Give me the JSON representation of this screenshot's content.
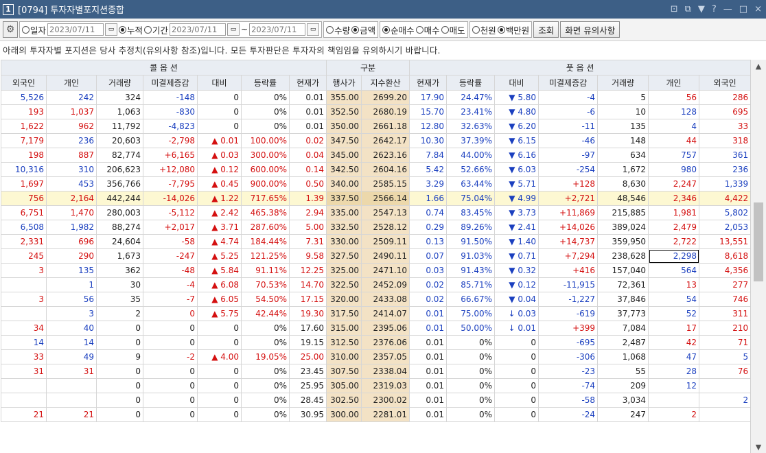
{
  "window": {
    "number": "1",
    "title": "[0794] 투자자별포지션종합",
    "controls": [
      "⊡",
      "⧉",
      "▼",
      "?",
      "—",
      "□",
      "×"
    ]
  },
  "toolbar": {
    "radio_ilja": "일자",
    "date_single": "2023/07/11",
    "radio_nujeok": "누적",
    "radio_gigan": "기간",
    "date_from": "2023/07/11",
    "date_sep": "~",
    "date_to": "2023/07/11",
    "radio_suryang": "수량",
    "radio_geumaek": "금액",
    "radio_sunmaesu": "순매수",
    "radio_maesu": "매수",
    "radio_maedo": "매도",
    "radio_cheonwon": "천원",
    "radio_baekmanwon": "백만원",
    "btn_query": "조회",
    "btn_notice": "화면 유의사항"
  },
  "notice_text": "아래의 투자자별 포지션은 당사 추정치(유의사항 참조)입니다. 모든 투자판단은 투자자의 책임임을 유의하시기 바랍니다.",
  "table": {
    "group_headers": {
      "call": "콜 옵 션",
      "mid": "구분",
      "put": "풋 옵 션"
    },
    "columns": [
      "외국인",
      "개인",
      "거래량",
      "미결제증감",
      "대비",
      "등락률",
      "현재가",
      "행사가",
      "지수환산",
      "현재가",
      "등락률",
      "대비",
      "미결제증감",
      "거래량",
      "개인",
      "외국인"
    ],
    "rows": [
      [
        "5,526",
        "242",
        "324",
        "-148",
        "0",
        "0%",
        "0.01",
        "355.00",
        "2699.20",
        "17.90",
        "24.47%",
        "▼ 5.80",
        "-4",
        "5",
        "56",
        "286"
      ],
      [
        "193",
        "1,037",
        "1,063",
        "-830",
        "0",
        "0%",
        "0.01",
        "352.50",
        "2680.19",
        "15.70",
        "23.41%",
        "▼ 4.80",
        "-6",
        "10",
        "128",
        "695"
      ],
      [
        "1,622",
        "962",
        "11,792",
        "-4,823",
        "0",
        "0%",
        "0.01",
        "350.00",
        "2661.18",
        "12.80",
        "32.63%",
        "▼ 6.20",
        "-11",
        "135",
        "4",
        "33"
      ],
      [
        "7,179",
        "236",
        "20,603",
        "-2,798",
        "▲ 0.01",
        "100.00%",
        "0.02",
        "347.50",
        "2642.17",
        "10.30",
        "37.39%",
        "▼ 6.15",
        "-46",
        "148",
        "44",
        "318"
      ],
      [
        "198",
        "887",
        "82,774",
        "+6,165",
        "▲ 0.03",
        "300.00%",
        "0.04",
        "345.00",
        "2623.16",
        "7.84",
        "44.00%",
        "▼ 6.16",
        "-97",
        "634",
        "757",
        "361"
      ],
      [
        "10,316",
        "310",
        "206,623",
        "+12,080",
        "▲ 0.12",
        "600.00%",
        "0.14",
        "342.50",
        "2604.16",
        "5.42",
        "52.66%",
        "▼ 6.03",
        "-254",
        "1,672",
        "980",
        "236"
      ],
      [
        "1,697",
        "453",
        "356,766",
        "-7,795",
        "▲ 0.45",
        "900.00%",
        "0.50",
        "340.00",
        "2585.15",
        "3.29",
        "63.44%",
        "▼ 5.71",
        "+128",
        "8,630",
        "2,247",
        "1,339"
      ],
      [
        "756",
        "2,164",
        "442,244",
        "-14,026",
        "▲ 1.22",
        "717.65%",
        "1.39",
        "337.50",
        "2566.14",
        "1.66",
        "75.04%",
        "▼ 4.99",
        "+2,721",
        "48,546",
        "2,346",
        "4,422"
      ],
      [
        "6,751",
        "1,470",
        "280,003",
        "-5,112",
        "▲ 2.42",
        "465.38%",
        "2.94",
        "335.00",
        "2547.13",
        "0.74",
        "83.45%",
        "▼ 3.73",
        "+11,869",
        "215,885",
        "1,981",
        "5,802"
      ],
      [
        "6,508",
        "1,982",
        "88,274",
        "+2,017",
        "▲ 3.71",
        "287.60%",
        "5.00",
        "332.50",
        "2528.12",
        "0.29",
        "89.26%",
        "▼ 2.41",
        "+14,026",
        "389,024",
        "2,479",
        "2,053"
      ],
      [
        "2,331",
        "696",
        "24,604",
        "-58",
        "▲ 4.74",
        "184.44%",
        "7.31",
        "330.00",
        "2509.11",
        "0.13",
        "91.50%",
        "▼ 1.40",
        "+14,737",
        "359,950",
        "2,722",
        "13,551"
      ],
      [
        "245",
        "290",
        "1,673",
        "-247",
        "▲ 5.25",
        "121.25%",
        "9.58",
        "327.50",
        "2490.11",
        "0.07",
        "91.03%",
        "▼ 0.71",
        "+7,294",
        "238,628",
        "2,298",
        "8,618"
      ],
      [
        "3",
        "135",
        "362",
        "-48",
        "▲ 5.84",
        "91.11%",
        "12.25",
        "325.00",
        "2471.10",
        "0.03",
        "91.43%",
        "▼ 0.32",
        "+416",
        "157,040",
        "564",
        "4,356"
      ],
      [
        "",
        "1",
        "30",
        "-4",
        "▲ 6.08",
        "70.53%",
        "14.70",
        "322.50",
        "2452.09",
        "0.02",
        "85.71%",
        "▼ 0.12",
        "-11,915",
        "72,361",
        "13",
        "277"
      ],
      [
        "3",
        "56",
        "35",
        "-7",
        "▲ 6.05",
        "54.50%",
        "17.15",
        "320.00",
        "2433.08",
        "0.02",
        "66.67%",
        "▼ 0.04",
        "-1,227",
        "37,846",
        "54",
        "746"
      ],
      [
        "",
        "3",
        "2",
        "0",
        "▲ 5.75",
        "42.44%",
        "19.30",
        "317.50",
        "2414.07",
        "0.01",
        "75.00%",
        "↓ 0.03",
        "-619",
        "37,773",
        "52",
        "311"
      ],
      [
        "34",
        "40",
        "0",
        "0",
        "0",
        "0%",
        "17.60",
        "315.00",
        "2395.06",
        "0.01",
        "50.00%",
        "↓ 0.01",
        "+399",
        "7,084",
        "17",
        "210"
      ],
      [
        "14",
        "14",
        "0",
        "0",
        "0",
        "0%",
        "19.15",
        "312.50",
        "2376.06",
        "0.01",
        "0%",
        "0",
        "-695",
        "2,487",
        "42",
        "71"
      ],
      [
        "33",
        "49",
        "9",
        "-2",
        "▲ 4.00",
        "19.05%",
        "25.00",
        "310.00",
        "2357.05",
        "0.01",
        "0%",
        "0",
        "-306",
        "1,068",
        "47",
        "5"
      ],
      [
        "31",
        "31",
        "0",
        "0",
        "0",
        "0%",
        "23.45",
        "307.50",
        "2338.04",
        "0.01",
        "0%",
        "0",
        "-23",
        "55",
        "28",
        "76"
      ],
      [
        "",
        "",
        "0",
        "0",
        "0",
        "0%",
        "25.95",
        "305.00",
        "2319.03",
        "0.01",
        "0%",
        "0",
        "-74",
        "209",
        "12",
        ""
      ],
      [
        "",
        "",
        "0",
        "0",
        "0",
        "0%",
        "28.45",
        "302.50",
        "2300.02",
        "0.01",
        "0%",
        "0",
        "-58",
        "3,034",
        "",
        "2"
      ],
      [
        "21",
        "21",
        "0",
        "0",
        "0",
        "0%",
        "30.95",
        "300.00",
        "2281.01",
        "0.01",
        "0%",
        "0",
        "-24",
        "247",
        "2",
        ""
      ]
    ],
    "highlight_row": 7,
    "selected_cell": [
      11,
      14
    ]
  },
  "colors": {
    "title_bg": "#3d5f86",
    "up": "#d41010",
    "down": "#1a3fbf",
    "mid_column_bg": "#f3e2c5",
    "highlight_row_bg": "#fdf8d2",
    "header_bg": "#e9edf3"
  }
}
